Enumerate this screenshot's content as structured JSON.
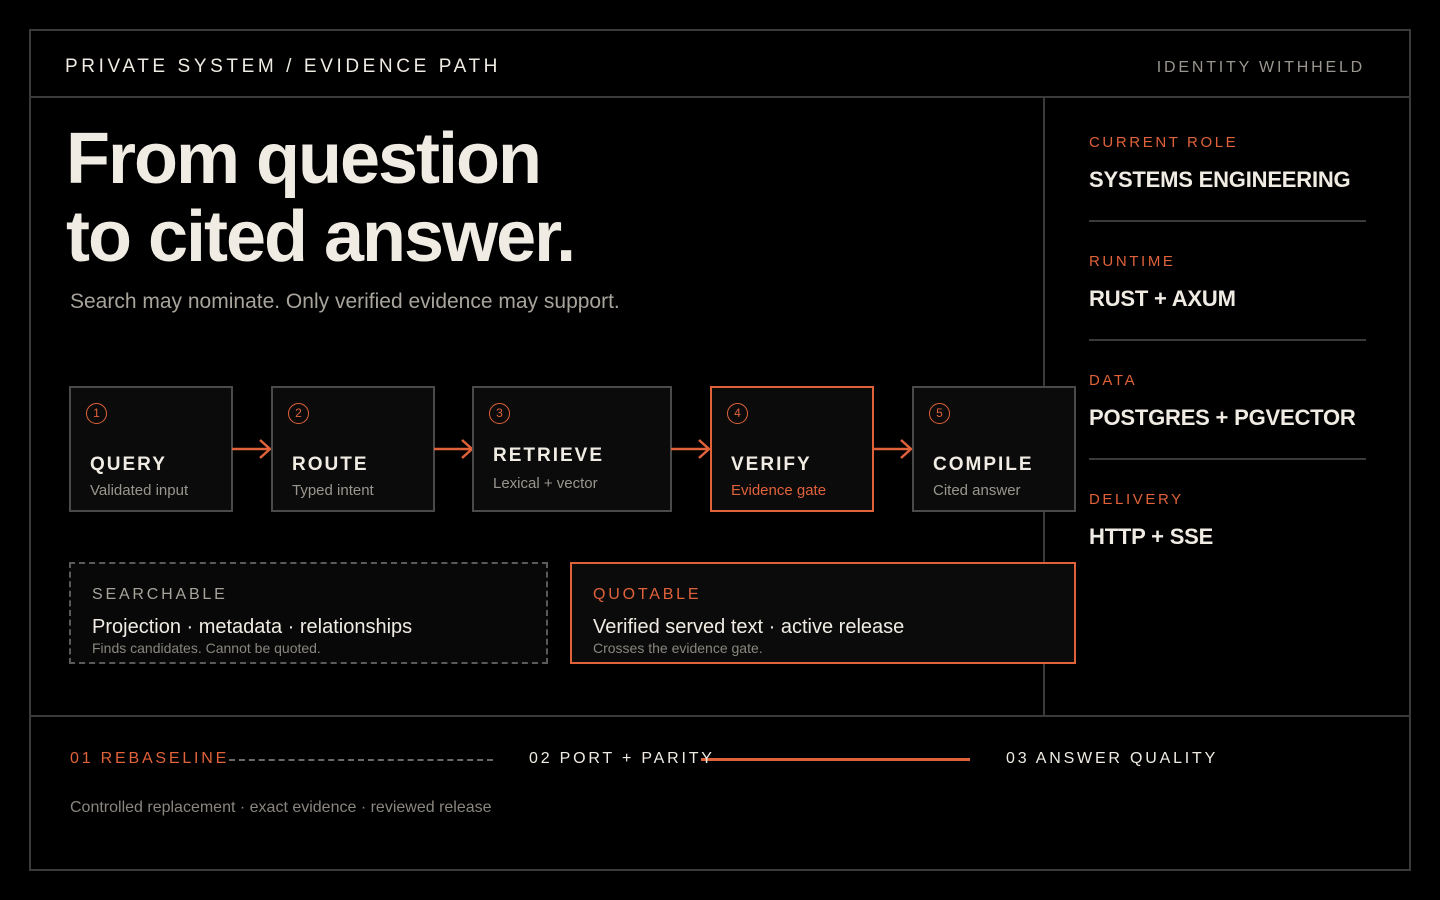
{
  "header": {
    "title": "PRIVATE SYSTEM / EVIDENCE PATH",
    "identity": "IDENTITY WITHHELD"
  },
  "hero": {
    "line1": "From question",
    "line2": "to cited answer.",
    "subtitle": "Search may nominate. Only verified evidence may support."
  },
  "steps": [
    {
      "num": "1",
      "name": "QUERY",
      "sub": "Validated input"
    },
    {
      "num": "2",
      "name": "ROUTE",
      "sub": "Typed intent"
    },
    {
      "num": "3",
      "name": "RETRIEVE",
      "sub": "Lexical + vector"
    },
    {
      "num": "4",
      "name": "VERIFY",
      "sub": "Evidence gate"
    },
    {
      "num": "5",
      "name": "COMPILE",
      "sub": "Cited answer"
    }
  ],
  "panels": {
    "searchable": {
      "title": "SEARCHABLE",
      "main": "Projection · metadata · relationships",
      "sub": "Finds candidates. Cannot be quoted."
    },
    "quotable": {
      "title": "QUOTABLE",
      "main": "Verified served text · active release",
      "sub": "Crosses the evidence gate."
    }
  },
  "sidebar": [
    {
      "label": "CURRENT ROLE",
      "value": "SYSTEMS ENGINEERING"
    },
    {
      "label": "RUNTIME",
      "value": "RUST + AXUM"
    },
    {
      "label": "DATA",
      "value": "POSTGRES + PGVECTOR"
    },
    {
      "label": "DELIVERY",
      "value": "HTTP + SSE"
    }
  ],
  "phases": {
    "p1": "01 REBASELINE",
    "p2": "02 PORT + PARITY",
    "p3": "03 ANSWER QUALITY",
    "note": "Controlled replacement · exact evidence · reviewed release"
  },
  "colors": {
    "accent": "#e0623a",
    "background": "#000000",
    "text": "#f0ece4",
    "border": "#3a3a3a"
  }
}
